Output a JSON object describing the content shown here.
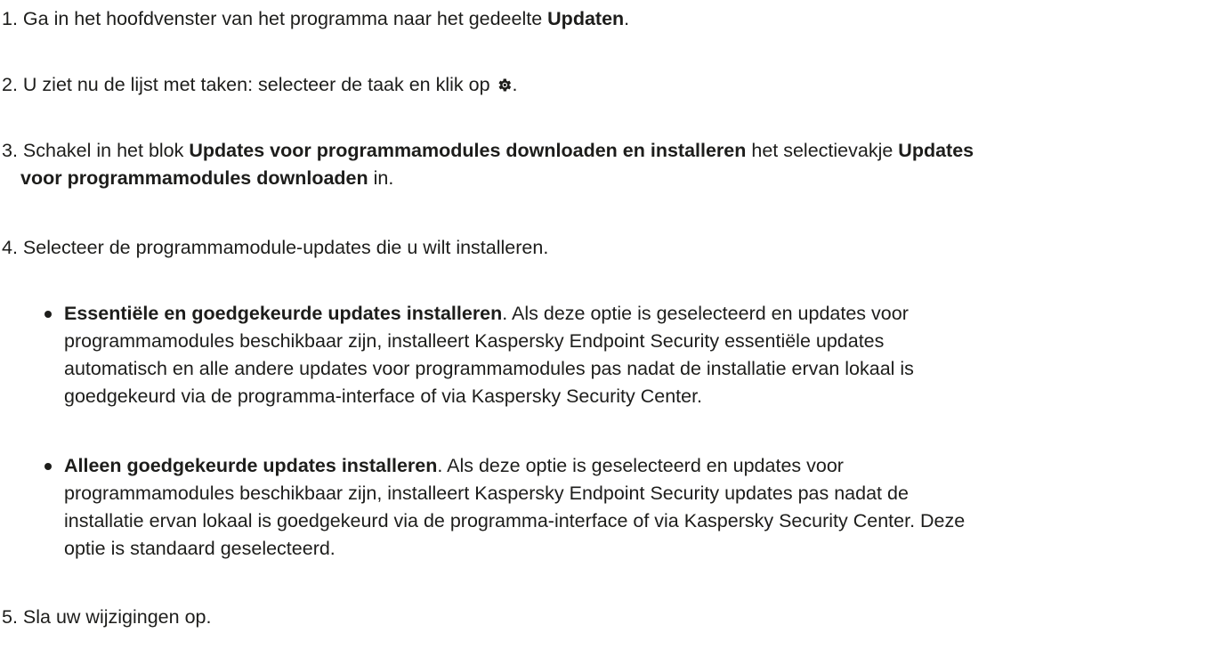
{
  "steps": [
    {
      "number": "1.",
      "parts": {
        "a": "Ga in het hoofdvenster van het programma naar het gedeelte ",
        "b": "Updaten",
        "c": "."
      }
    },
    {
      "number": "2.",
      "parts": {
        "a": "U ziet nu de lijst met taken: selecteer de taak en klik op ",
        "icon": "gear-icon",
        "c": "."
      }
    },
    {
      "number": "3.",
      "parts": {
        "a": "Schakel in het blok ",
        "b": "Updates voor programmamodules downloaden en installeren",
        "c": " het selectievakje ",
        "d": "Updates",
        "e": "voor programmamodules downloaden",
        "f": " in."
      }
    },
    {
      "number": "4.",
      "parts": {
        "a": "Selecteer de programmamodule-updates die u wilt installeren."
      }
    },
    {
      "number": "5.",
      "parts": {
        "a": "Sla uw wijzigingen op."
      }
    }
  ],
  "options": [
    {
      "title": "Essentiële en goedgekeurde updates installeren",
      "line1": ". Als deze optie is geselecteerd en updates voor",
      "line2": "programmamodules beschikbaar zijn, installeert Kaspersky Endpoint Security essentiële updates",
      "line3": "automatisch en alle andere updates voor programmamodules pas nadat de installatie ervan lokaal is",
      "line4": "goedgekeurd via de programma-interface of via Kaspersky Security Center."
    },
    {
      "title": "Alleen goedgekeurde updates installeren",
      "line1": ". Als deze optie is geselecteerd en updates voor",
      "line2": "programmamodules beschikbaar zijn, installeert Kaspersky Endpoint Security updates pas nadat de",
      "line3": "installatie ervan lokaal is goedgekeurd via de programma-interface of via Kaspersky Security Center. Deze",
      "line4": "optie is standaard geselecteerd."
    }
  ]
}
